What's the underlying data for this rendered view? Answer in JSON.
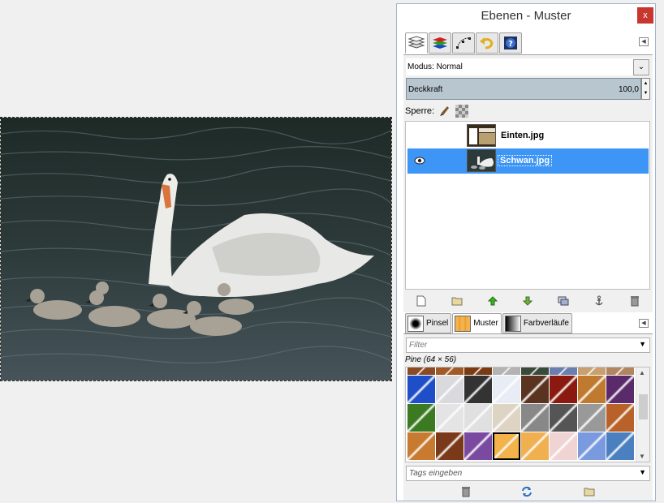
{
  "window": {
    "title": "Ebenen - Muster",
    "close_label": "x"
  },
  "layers_panel": {
    "tabs": [
      "layers-icon",
      "channels-icon",
      "paths-icon",
      "undo-icon",
      "help-icon"
    ],
    "mode_label": "Modus:",
    "mode_value": "Normal",
    "opacity_label": "Deckkraft",
    "opacity_value": "100,0",
    "lock_label": "Sperre:",
    "layers": [
      {
        "name": "Einten.jpg",
        "visible": false,
        "selected": false
      },
      {
        "name": "Schwan.jpg",
        "visible": true,
        "selected": true
      }
    ],
    "tools": [
      "new-layer-icon",
      "new-group-icon",
      "raise-layer-icon",
      "lower-layer-icon",
      "duplicate-layer-icon",
      "anchor-icon",
      "delete-layer-icon"
    ]
  },
  "pattern_panel": {
    "tabs": [
      {
        "label": "Pinsel",
        "active": false
      },
      {
        "label": "Muster",
        "active": true
      },
      {
        "label": "Farbverläufe",
        "active": false
      }
    ],
    "filter_placeholder": "Filter",
    "selected_pattern": "Pine (64 × 56)",
    "tags_placeholder": "Tags eingeben",
    "swatch_colors": [
      "#8b4a22",
      "#a05a28",
      "#7a3a12",
      "#b3b3b3",
      "#3a4a3a",
      "#6a7fb0",
      "#c8a070",
      "#b08560",
      "#1f4fc8",
      "#d9d9de",
      "#333333",
      "#e8ecf4",
      "#5a3420",
      "#8a1a10",
      "#c07a30",
      "#5a2a6a",
      "#3c7a22",
      "#e4e4e4",
      "#e0e0e0",
      "#ddd4c4",
      "#888888",
      "#555555",
      "#999999",
      "#b8622a",
      "#c77a30",
      "#7a3a1a",
      "#7a4aa0",
      "#f3b24a",
      "#f0b050",
      "#f0d4d4",
      "#7a9ae0",
      "#4a80c0"
    ],
    "selected_index": 27,
    "tools": [
      "delete-pattern-icon",
      "refresh-icon",
      "open-folder-icon"
    ]
  }
}
